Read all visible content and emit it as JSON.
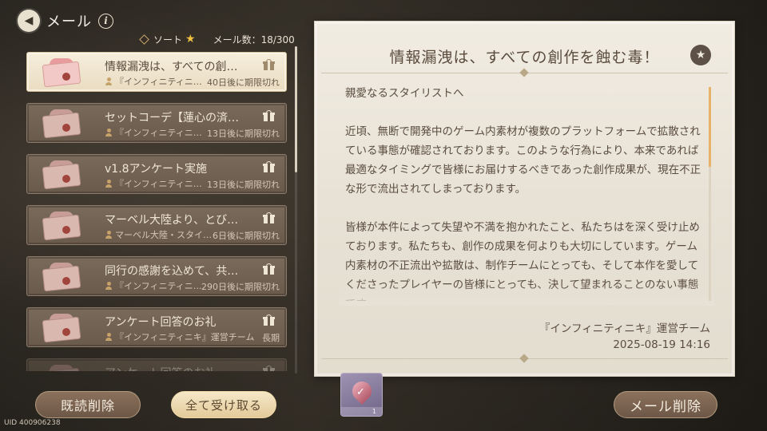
{
  "header": {
    "title": "メール",
    "back_icon": "back-arrow-icon",
    "info_icon": "info-icon"
  },
  "sortbar": {
    "sort_label": "ソート",
    "count_text": "メール数：18/300"
  },
  "mails": [
    {
      "subject": "情報漏洩は、すべての創…",
      "sender": "『インフィニティニ…",
      "expiry": "40日後に期限切れ",
      "selected": true
    },
    {
      "subject": "セットコーデ【蓮心の済…",
      "sender": "『インフィニティニ…",
      "expiry": "13日後に期限切れ"
    },
    {
      "subject": "v1.8アンケート実施",
      "sender": "『インフィニティニ…",
      "expiry": "13日後に期限切れ"
    },
    {
      "subject": "マーベル大陸より、とび…",
      "sender": "マーベル大陸・スタイ…",
      "expiry": "6日後に期限切れ"
    },
    {
      "subject": "同行の感謝を込めて、共…",
      "sender": "『インフィニティニ…",
      "expiry": "290日後に期限切れ"
    },
    {
      "subject": "アンケート回答のお礼",
      "sender": "『インフィニティニキ』運営チーム",
      "expiry": "長期"
    },
    {
      "subject": "アンケート回答のお礼",
      "sender": "",
      "expiry": ""
    }
  ],
  "list_scroll": {
    "position": 0.0
  },
  "buttons": {
    "delete_read": "既読削除",
    "receive_all": "全て受け取る",
    "delete_mail": "メール削除"
  },
  "uid": "UID 400906238",
  "detail": {
    "title": "情報漏洩は、すべての創作を蝕む毒！",
    "greeting": "親愛なるスタイリストへ",
    "paragraph1": "近頃、無断で開発中のゲーム内素材が複数のプラットフォームで拡散されている事態が確認されております。このような行為により、本来であれば最適なタイミングで皆様にお届けするべきであった創作成果が、現在不正な形で流出されてしまっております。",
    "paragraph2": "皆様が本件によって失望や不満を抱かれたこと、私たちはを深く受け止めております。私たちも、創作の成果を何よりも大切にしています。ゲーム内素材の不正流出や拡散は、制作チームにとっても、そして本作を愛してくださったプレイヤーの皆様にとっても、決して望まれることのない事態です。",
    "signature": "『インフィニティニキ』運営チーム",
    "date": "2025-08-19 14:16"
  },
  "attachment": {
    "quantity": "1",
    "icon": "check-gem-icon"
  },
  "colors": {
    "accent_gold": "#f0c040",
    "panel_bg": "#ece6db",
    "scroll_thumb": "#e8b26a"
  }
}
